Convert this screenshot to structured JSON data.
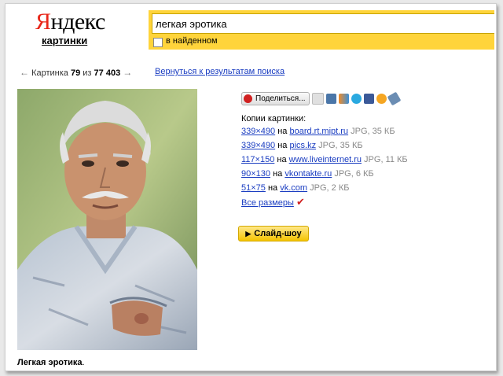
{
  "logo": {
    "text_red": "Я",
    "text_black": "ндекс",
    "sub": "картинки"
  },
  "search": {
    "query": "легкая эротика",
    "checkbox_label": "в найденном"
  },
  "nav": {
    "prefix": "Картинка",
    "index": "79",
    "of": "из",
    "total": "77 403",
    "prev_arrow": "←",
    "next_arrow": "→",
    "back_link": "Вернуться к результатам поиска"
  },
  "share": {
    "button_label": "Поделиться..."
  },
  "copies": {
    "title": "Копии картинки:",
    "items": [
      {
        "size": "339×490",
        "on": "на",
        "site": "board.rt.mipt.ru",
        "meta": "JPG, 35 КБ"
      },
      {
        "size": "339×490",
        "on": "на",
        "site": "pics.kz",
        "meta": "JPG, 35 КБ"
      },
      {
        "size": "117×150",
        "on": "на",
        "site": "www.liveinternet.ru",
        "meta": "JPG, 11 КБ"
      },
      {
        "size": "90×130",
        "on": "на",
        "site": "vkontakte.ru",
        "meta": "JPG, 6 КБ"
      },
      {
        "size": "51×75",
        "on": "на",
        "site": "vk.com",
        "meta": "JPG, 2 КБ"
      }
    ],
    "all_sizes": "Все размеры"
  },
  "slideshow": {
    "label": "Слайд-шоу"
  },
  "caption": {
    "bold": "Легкая эротика",
    "rest": "."
  },
  "colors": {
    "accent": "#ffd43b",
    "link": "#1a3dc1",
    "logo_red": "#e8271a"
  }
}
